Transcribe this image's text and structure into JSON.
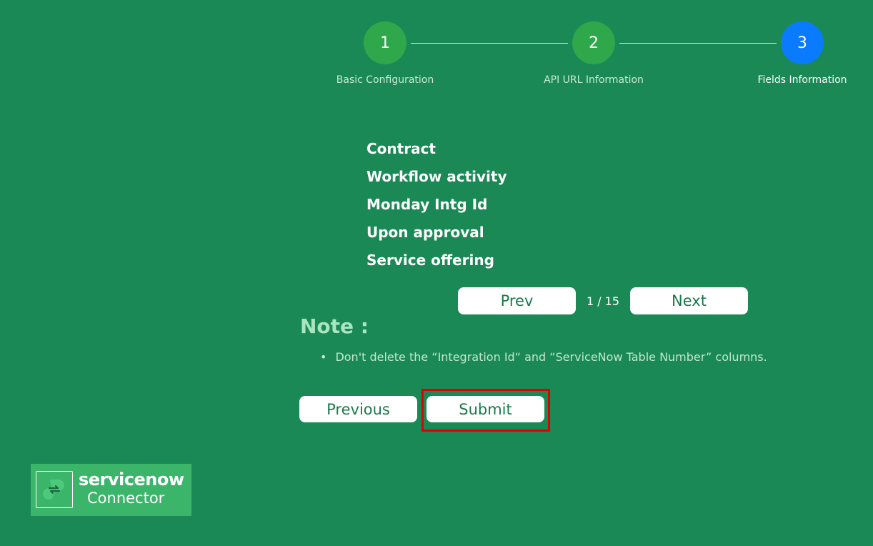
{
  "stepper": {
    "steps": [
      {
        "number": "1",
        "label": "Basic Configuration",
        "state": "done"
      },
      {
        "number": "2",
        "label": "API URL Information",
        "state": "done"
      },
      {
        "number": "3",
        "label": "Fields Information",
        "state": "active"
      }
    ]
  },
  "fields": {
    "items": [
      "Contract",
      "Workflow activity",
      "Monday Intg Id",
      "Upon approval",
      "Service offering"
    ]
  },
  "pagination": {
    "prev_label": "Prev",
    "next_label": "Next",
    "current_page": 1,
    "total_pages": 15,
    "count_text": "1 / 15"
  },
  "note": {
    "title": "Note :",
    "items": [
      "Don't delete the “Integration Id“ and “ServiceNow Table Number” columns."
    ]
  },
  "actions": {
    "previous_label": "Previous",
    "submit_label": "Submit"
  },
  "logo": {
    "brand": "servicenow",
    "sub": "Connector"
  },
  "colors": {
    "background": "#1a8955",
    "step_done": "#2ea84a",
    "step_active": "#0a7bff",
    "highlight": "#e00000",
    "button_text": "#1a7a4c"
  }
}
